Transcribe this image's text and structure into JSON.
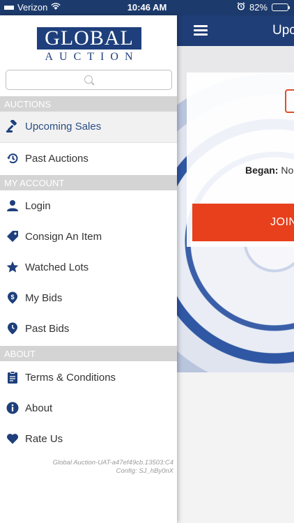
{
  "status_bar": {
    "carrier": "Verizon",
    "time": "10:46 AM",
    "battery": "82%",
    "battery_level": 0.82
  },
  "background_screen": {
    "title": "Upc",
    "began_label": "Began:",
    "began_value": "No",
    "join_button": "JOIN"
  },
  "logo": {
    "top": "GLOBAL",
    "bottom": "AUCTION"
  },
  "search": {
    "placeholder": ""
  },
  "sections": {
    "auctions": "AUCTIONS",
    "my_account": "MY ACCOUNT",
    "about": "ABOUT"
  },
  "menu": {
    "upcoming_sales": "Upcoming Sales",
    "past_auctions": "Past Auctions",
    "login": "Login",
    "consign": "Consign An Item",
    "watched_lots": "Watched Lots",
    "my_bids": "My Bids",
    "past_bids": "Past Bids",
    "terms": "Terms & Conditions",
    "about": "About",
    "rate_us": "Rate Us"
  },
  "version": {
    "line1": "Global Auction-UAT-a47ef49cb.13503:C4",
    "line2": "Config: SJ_hBy0nX"
  },
  "icons": {
    "upcoming_sales": "gavel-icon",
    "past_auctions": "history-icon",
    "login": "user-icon",
    "consign": "tag-icon",
    "watched_lots": "star-icon",
    "my_bids": "dollar-pin-icon",
    "past_bids": "clock-pin-icon",
    "terms": "clipboard-icon",
    "about": "info-icon",
    "rate_us": "heart-icon"
  },
  "colors": {
    "brand_navy": "#1e3f7c",
    "join_orange": "#e8401c",
    "section_gray": "#d4d4d4"
  }
}
